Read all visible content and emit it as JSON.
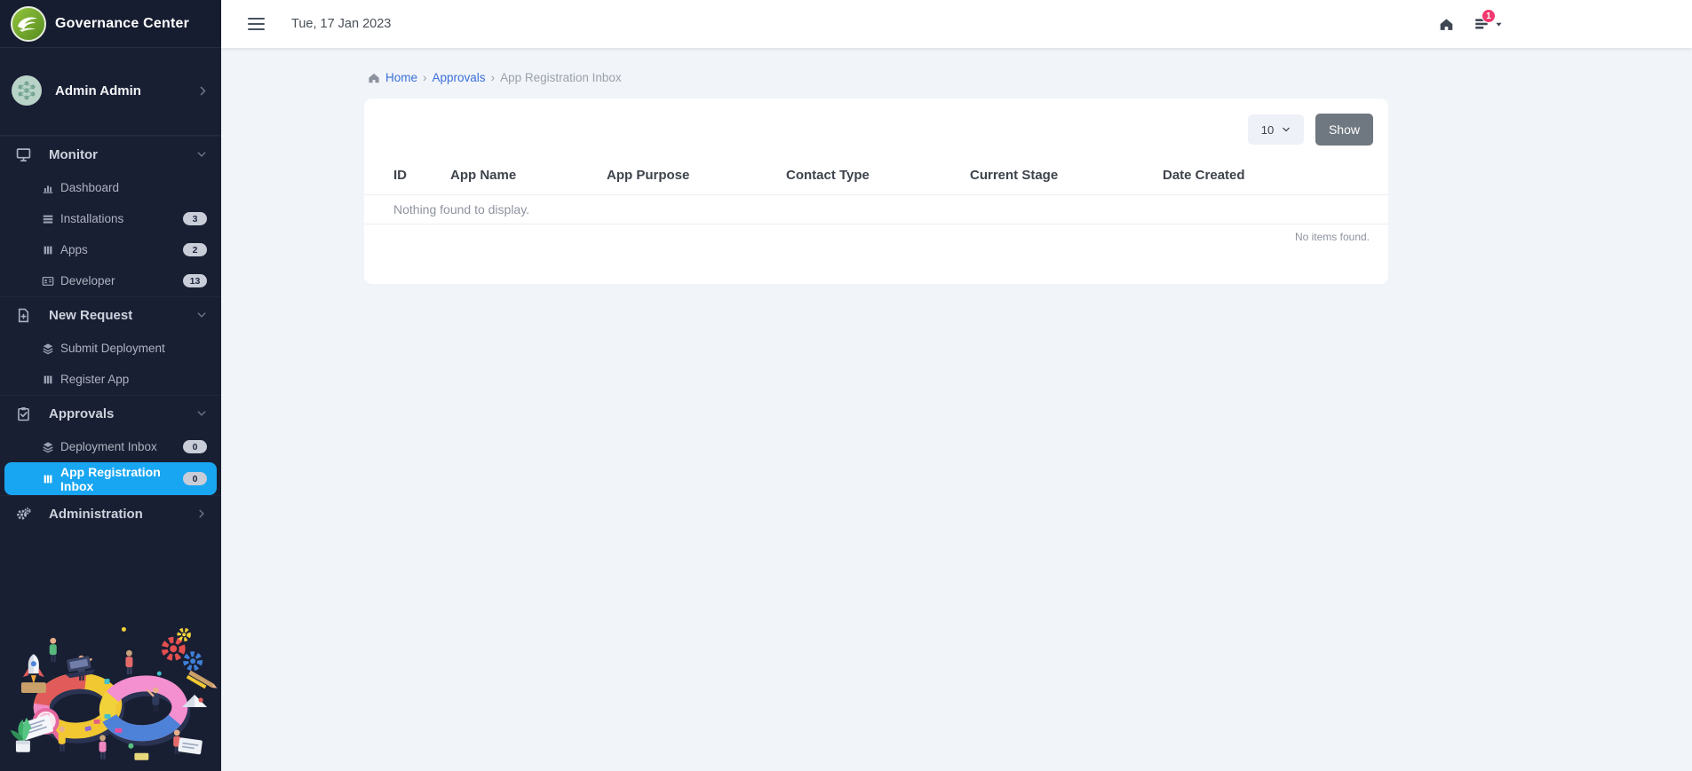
{
  "app": {
    "title": "Governance Center"
  },
  "topbar": {
    "date": "Tue, 17 Jan 2023",
    "notification_count": "1"
  },
  "sidebar": {
    "user": {
      "name": "Admin Admin"
    },
    "sections": [
      {
        "label": "Monitor",
        "items": [
          {
            "label": "Dashboard"
          },
          {
            "label": "Installations",
            "badge": "3"
          },
          {
            "label": "Apps",
            "badge": "2"
          },
          {
            "label": "Developer",
            "badge": "13"
          }
        ]
      },
      {
        "label": "New Request",
        "items": [
          {
            "label": "Submit Deployment"
          },
          {
            "label": "Register App"
          }
        ]
      },
      {
        "label": "Approvals",
        "items": [
          {
            "label": "Deployment Inbox",
            "badge": "0"
          },
          {
            "label": "App Registration Inbox",
            "badge": "0",
            "active": true
          }
        ]
      },
      {
        "label": "Administration",
        "items": []
      }
    ]
  },
  "breadcrumb": {
    "separator": "›",
    "items": [
      {
        "label": "Home"
      },
      {
        "label": "Approvals"
      },
      {
        "label": "App Registration Inbox"
      }
    ]
  },
  "main": {
    "page_size": "10",
    "show_button": "Show",
    "table": {
      "headers": [
        "ID",
        "App Name",
        "App Purpose",
        "Contact Type",
        "Current Stage",
        "Date Created"
      ],
      "empty_message": "Nothing found to display.",
      "items_status": "No items found."
    }
  },
  "colors": {
    "accent_blue": "#18a6f2",
    "link_blue": "#3b6fd9",
    "badge_pink": "#f1396f",
    "sidebar_bg": "#191f33",
    "content_bg": "#f1f4f8"
  }
}
